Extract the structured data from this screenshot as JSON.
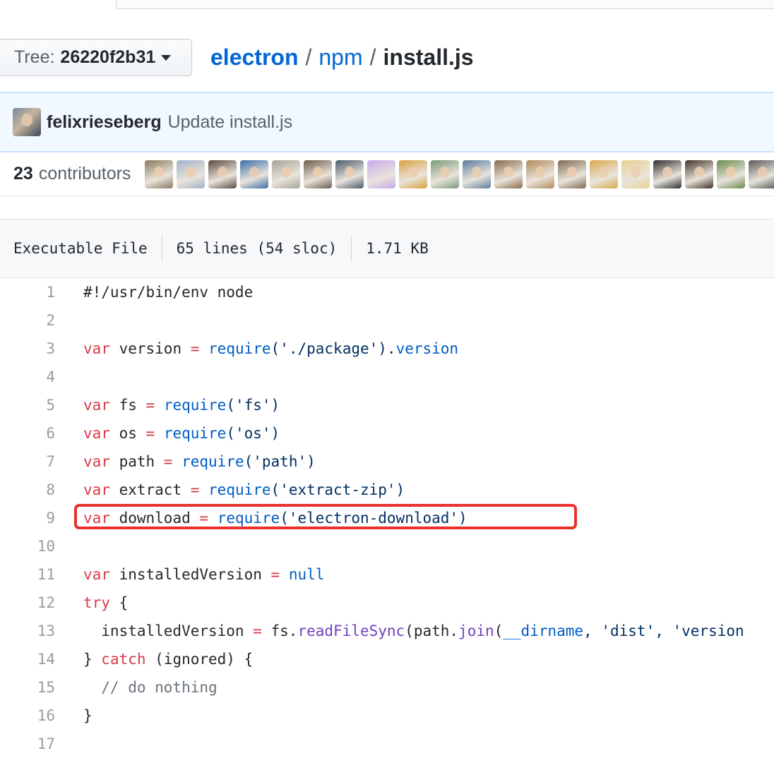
{
  "tree_button": {
    "label": "Tree:",
    "sha": "26220f2b31"
  },
  "breadcrumb": {
    "repo": "electron",
    "dir": "npm",
    "file": "install.js",
    "separator": "/"
  },
  "commit": {
    "author": "felixrieseberg",
    "message": "Update install.js"
  },
  "contributors": {
    "count": "23",
    "label": "contributors",
    "avatar_colors": [
      "#8a7a5e",
      "#9fb2c8",
      "#5a4a3e",
      "#3a6ea5",
      "#a8a49a",
      "#6b5b4b",
      "#4a5a6a",
      "#c9a8e8",
      "#d9a040",
      "#7a9a7a",
      "#5d7d9d",
      "#8a6a4a",
      "#b08a5a",
      "#7e6a4e",
      "#d8a848",
      "#e8d090",
      "#2e2e2e",
      "#3e3222",
      "#6a8a4a",
      "#5a5a5a"
    ]
  },
  "file_info": {
    "mode": "Executable File",
    "lines": "65 lines (54 sloc)",
    "size": "1.71 KB"
  },
  "code_lines": [
    {
      "n": "1"
    },
    {
      "n": "2"
    },
    {
      "n": "3"
    },
    {
      "n": "4"
    },
    {
      "n": "5"
    },
    {
      "n": "6"
    },
    {
      "n": "7"
    },
    {
      "n": "8"
    },
    {
      "n": "9"
    },
    {
      "n": "10"
    },
    {
      "n": "11"
    },
    {
      "n": "12"
    },
    {
      "n": "13"
    },
    {
      "n": "14"
    },
    {
      "n": "15"
    },
    {
      "n": "16"
    },
    {
      "n": "17"
    }
  ],
  "tokens": {
    "l1": "#!/usr/bin/env node",
    "var": "var",
    "eq": " = ",
    "require": "require",
    "l3_name": " version",
    "l3_arg": "('./package')",
    "l3_dot": ".",
    "l3_prop": "version",
    "l5_name": " fs",
    "l5_arg": "('fs')",
    "l6_name": " os",
    "l6_arg": "('os')",
    "l7_name": " path",
    "l7_arg": "('path')",
    "l8_name": " extract",
    "l8_arg": "('extract-zip')",
    "l9_name": " download",
    "l9_arg": "('electron-download')",
    "l11_name": " installedVersion",
    "null": "null",
    "try": "try",
    "open_brace": " {",
    "l13_indent": "  installedVersion",
    "l13_fs": "fs.",
    "l13_read": "readFileSync",
    "l13_path": "(path.",
    "l13_join": "join",
    "l13_paren": "(",
    "l13_dirname": "__dirname",
    "l13_rest": ", 'dist', 'version",
    "close_brace": "} ",
    "catch": "catch",
    "l14_rest": " (ignored) {",
    "l15": "  // do nothing",
    "l16": "}"
  },
  "colors": {
    "keyword": "#d73a49",
    "builtin": "#005cc5",
    "string": "#032f62",
    "method": "#6f42c1",
    "comment": "#6a737d",
    "highlight_border": "#e8302c"
  }
}
